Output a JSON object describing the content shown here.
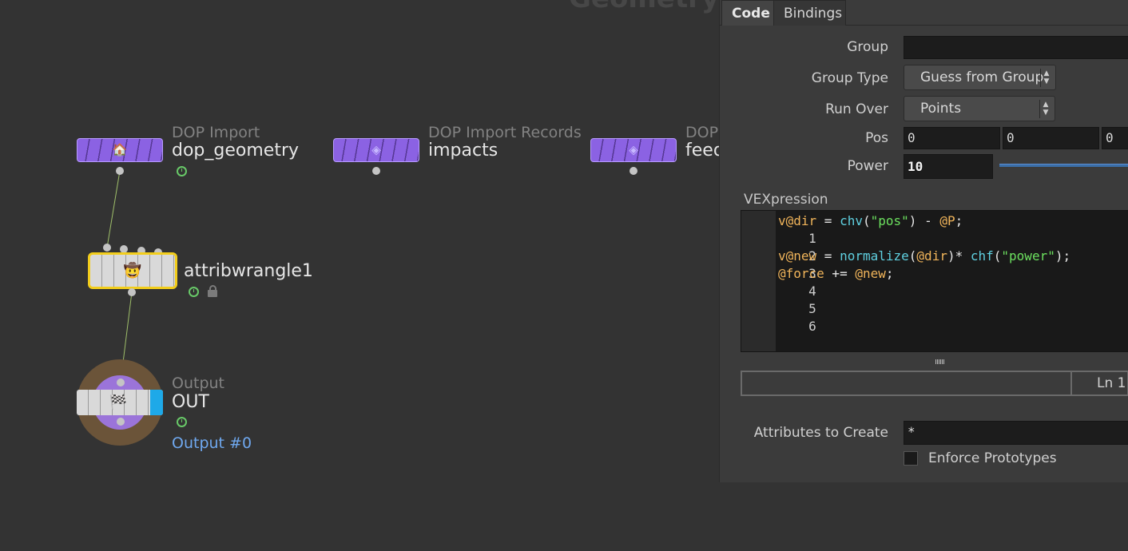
{
  "network": {
    "context_title": "Geometry",
    "nodes": [
      {
        "type_label": "DOP Import",
        "name": "dop_geometry",
        "icon": "dop-import-icon"
      },
      {
        "type_label": "DOP Import Records",
        "name": "impacts",
        "icon": "dop-import-records-icon"
      },
      {
        "type_label": "DOP",
        "name": "feed",
        "icon": "dop-import-records-icon"
      }
    ],
    "wrangle": {
      "name": "attribwrangle1",
      "icon": "wrangle-icon"
    },
    "output": {
      "type_label": "Output",
      "name": "OUT",
      "output_label": "Output #0",
      "icon": "checkered-flag-icon"
    }
  },
  "parameters": {
    "tabs": [
      {
        "label": "Code",
        "active": true
      },
      {
        "label": "Bindings",
        "active": false
      }
    ],
    "group": {
      "label": "Group",
      "value": ""
    },
    "group_type": {
      "label": "Group Type",
      "value": "Guess from Group"
    },
    "run_over": {
      "label": "Run Over",
      "value": "Points"
    },
    "pos": {
      "label": "Pos",
      "values": [
        "0",
        "0",
        "0"
      ]
    },
    "power": {
      "label": "Power",
      "value": "10"
    },
    "vexpression": {
      "label": "VEXpression",
      "lines": [
        {
          "num": "1",
          "code": "v@dir = chv(\"pos\") - @P;"
        },
        {
          "num": "2",
          "code": ""
        },
        {
          "num": "3",
          "code": "v@new = normalize(@dir)* chf(\"power\");"
        },
        {
          "num": "4",
          "code": "@force += @new;"
        },
        {
          "num": "5",
          "code": ""
        },
        {
          "num": "6",
          "code": ""
        }
      ],
      "status_line": "Ln 1"
    },
    "attributes_to_create": {
      "label": "Attributes to Create",
      "value": "*"
    },
    "enforce_prototypes": {
      "label": "Enforce Prototypes",
      "checked": false
    }
  },
  "colors": {
    "dop_node": "#8b62e3",
    "selected_outline": "#f2cd1c",
    "output_flag": "#1ea9e8",
    "string": "#6ce05f",
    "function": "#5fd0e0",
    "variable": "#f0b45a"
  }
}
